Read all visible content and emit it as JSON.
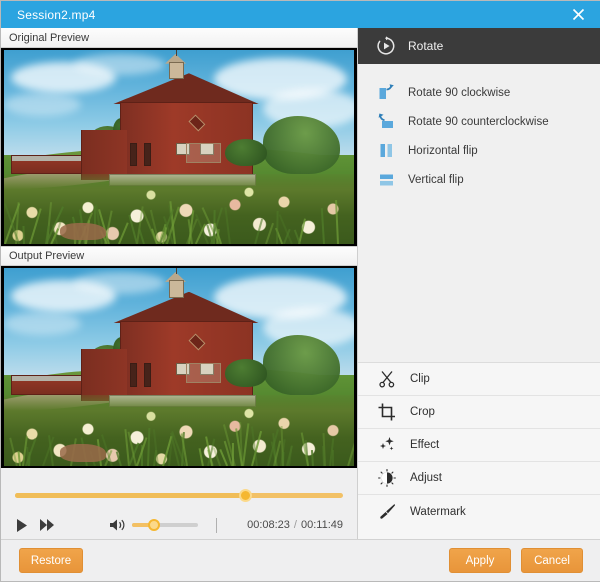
{
  "window": {
    "title": "Session2.mp4",
    "close_label": "×",
    "titlebar_color": "#2ba4e0"
  },
  "preview": {
    "original_label": "Original Preview",
    "output_label": "Output Preview"
  },
  "player": {
    "play_label": "Play",
    "forward_label": "Fast forward",
    "volume_label": "Volume",
    "progress_percent": 70,
    "volume_percent": 34,
    "current_time": "00:08:23",
    "separator": "/",
    "total_time": "00:11:49",
    "accent_color": "#f5b731"
  },
  "panel": {
    "header": {
      "title": "Rotate",
      "icon": "rotate-play-icon"
    },
    "rotate_items": [
      {
        "label": "Rotate 90 clockwise",
        "icon": "rotate-cw-icon"
      },
      {
        "label": "Rotate 90 counterclockwise",
        "icon": "rotate-ccw-icon"
      },
      {
        "label": "Horizontal flip",
        "icon": "flip-horizontal-icon"
      },
      {
        "label": "Vertical flip",
        "icon": "flip-vertical-icon"
      }
    ],
    "tool_items": [
      {
        "label": "Clip",
        "icon": "scissors-icon"
      },
      {
        "label": "Crop",
        "icon": "crop-icon"
      },
      {
        "label": "Effect",
        "icon": "sparkle-icon"
      },
      {
        "label": "Adjust",
        "icon": "brightness-icon"
      },
      {
        "label": "Watermark",
        "icon": "brush-icon"
      }
    ],
    "icon_color": "#4a9fd8",
    "header_color": "#3b3b3b"
  },
  "footer": {
    "restore_label": "Restore",
    "apply_label": "Apply",
    "cancel_label": "Cancel",
    "button_color": "#eb9d3e"
  }
}
